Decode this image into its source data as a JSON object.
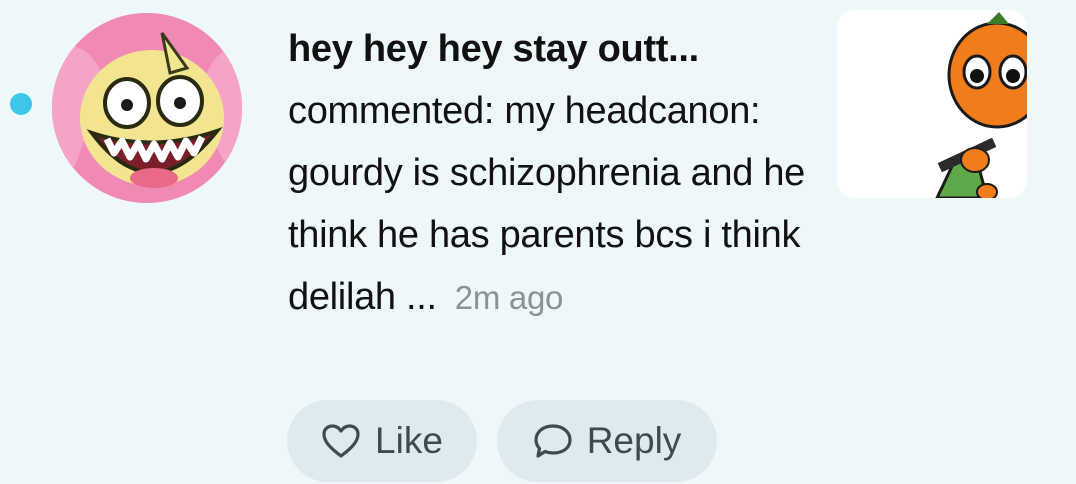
{
  "notification": {
    "username": "hey hey hey stay outt...",
    "comment": "commented: my headcanon: gourdy is schizophrenia and he think he has parents bcs i think delilah ...",
    "timestamp": "2m ago",
    "unread": true
  },
  "actions": {
    "like_label": "Like",
    "reply_label": "Reply"
  },
  "icons": {
    "like": "heart-icon",
    "reply": "speech-bubble-icon"
  },
  "colors": {
    "background": "#eef8fb",
    "unread_dot": "#3ec6e8",
    "pill_background": "#dfeaee",
    "timestamp": "#8a9296"
  }
}
